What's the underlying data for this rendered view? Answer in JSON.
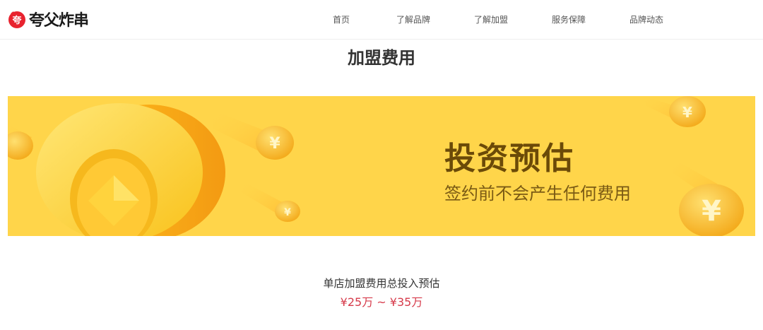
{
  "brand": {
    "logo_text": "夸父炸串",
    "logo_mark_glyph": "夸",
    "accent_color": "#e8232f"
  },
  "nav": {
    "items": [
      "首页",
      "了解品牌",
      "了解加盟",
      "服务保障",
      "品牌动态"
    ]
  },
  "section": {
    "title": "加盟费用"
  },
  "banner": {
    "headline": "投资预估",
    "subline": "签约前不会产生任何费用",
    "background_color": "#ffd54a",
    "coin_glyph": "¥"
  },
  "estimate": {
    "label": "单店加盟费用总投入预估",
    "range": "¥25万 ~ ¥35万",
    "range_color": "#d63a4a"
  }
}
